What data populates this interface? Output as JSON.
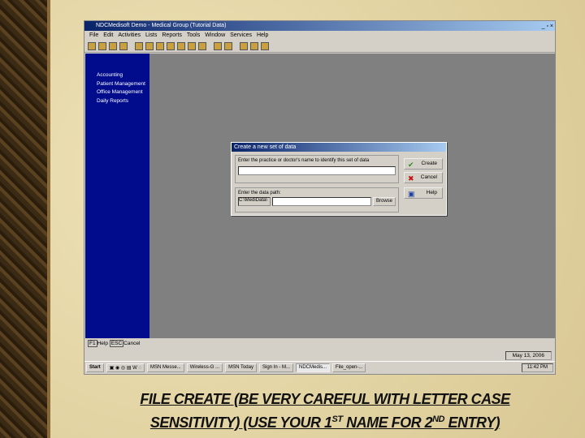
{
  "window": {
    "title": "NDCMedisoft Demo - Medical Group (Tutorial Data)",
    "controls": "_ ▫ ×"
  },
  "menu": [
    "File",
    "Edit",
    "Activities",
    "Lists",
    "Reports",
    "Tools",
    "Window",
    "Services",
    "Help"
  ],
  "sidebar": [
    "Accounting",
    "Patient Management",
    "Office Management",
    "Daily Reports"
  ],
  "dialog": {
    "title": "Create a new set of data",
    "name_label": "Enter the practice or doctor's name to identify this set of data",
    "name_value": "",
    "path_label": "Enter the data path:",
    "path_prefix": "C:\\MediData\\",
    "path_value": "",
    "browse": "Browse",
    "create": "Create",
    "cancel": "Cancel",
    "help": "Help"
  },
  "status": {
    "help": "Help",
    "cancel": "Cancel",
    "f1": "F1",
    "esc": "ESC",
    "date": "May 13, 2006"
  },
  "taskbar": {
    "start": "Start",
    "items": [
      "MSN Messe...",
      "Wireless-G ...",
      "MSN Today",
      "Sign In - M...",
      "NDCMedis...",
      "File_open-..."
    ],
    "time": "11:42 PM"
  },
  "caption": {
    "line1": "FILE CREATE (BE VERY CAREFUL WITH LETTER CASE",
    "line2a": "SENSITIVITY) (USE YOUR 1",
    "sup1": "ST",
    "line2b": " NAME FOR 2",
    "sup2": "ND",
    "line2c": " ENTRY)"
  }
}
